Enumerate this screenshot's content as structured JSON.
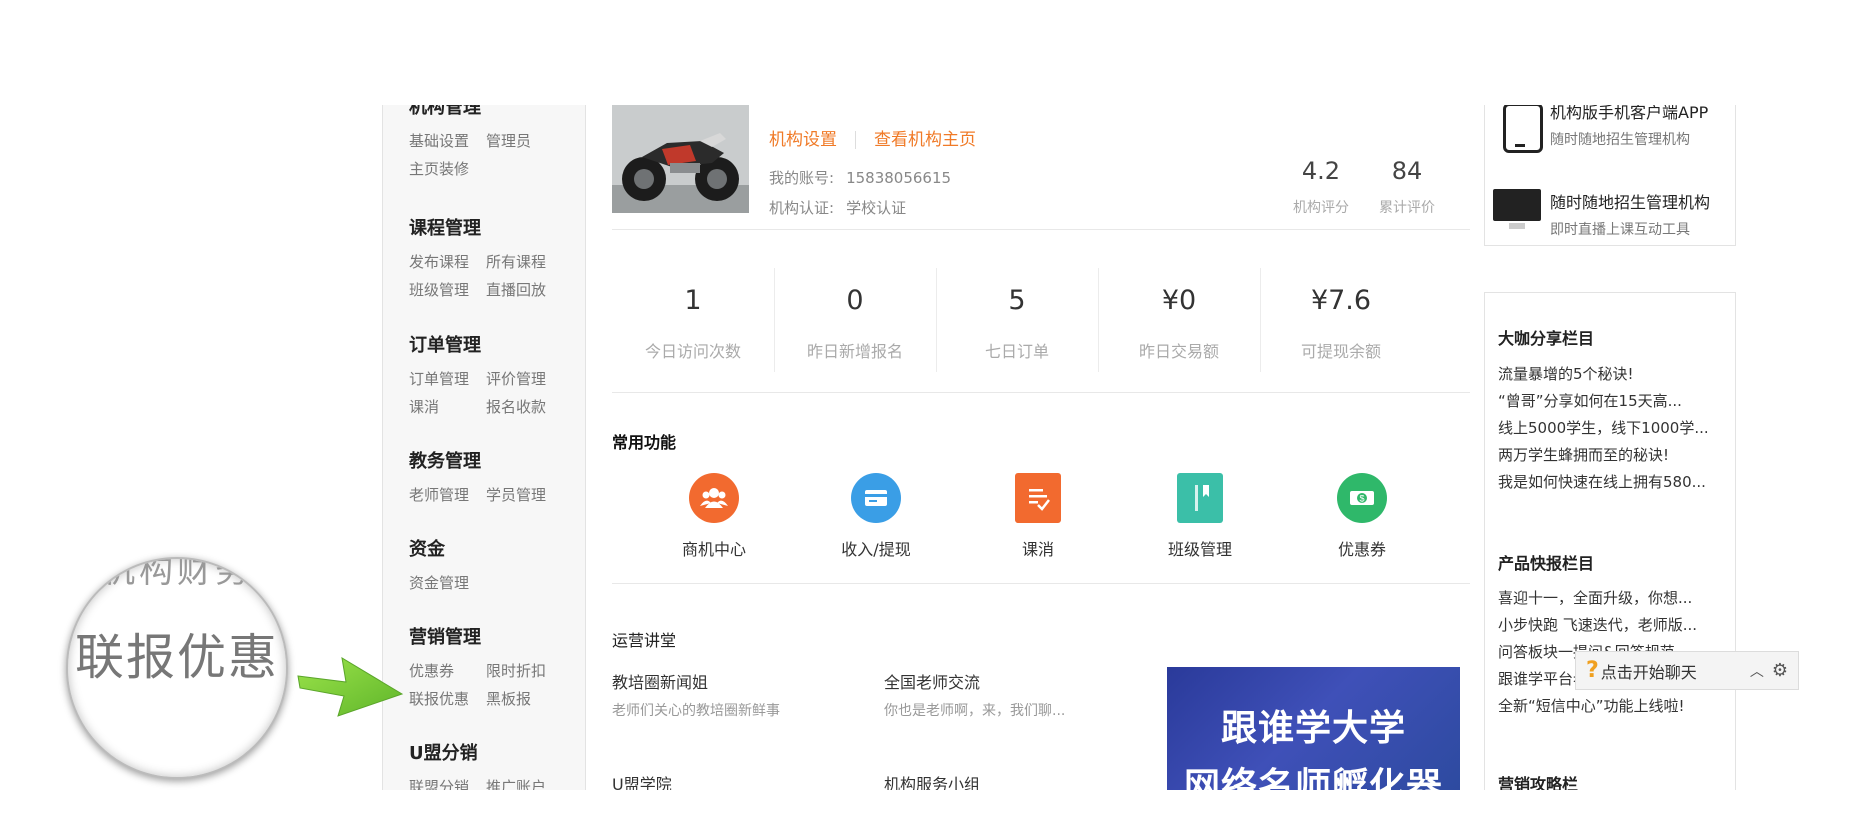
{
  "sidebar": {
    "groups": [
      {
        "title": "机构管理",
        "links": [
          [
            "基础设置",
            "管理员"
          ],
          [
            "主页装修",
            ""
          ]
        ]
      },
      {
        "title": "课程管理",
        "links": [
          [
            "发布课程",
            "所有课程"
          ],
          [
            "班级管理",
            "直播回放"
          ]
        ]
      },
      {
        "title": "订单管理",
        "links": [
          [
            "订单管理",
            "评价管理"
          ],
          [
            "课消",
            "报名收款"
          ]
        ]
      },
      {
        "title": "教务管理",
        "links": [
          [
            "老师管理",
            "学员管理"
          ]
        ]
      },
      {
        "title": "资金",
        "links": [
          [
            "资金管理",
            ""
          ]
        ]
      },
      {
        "title": "营销管理",
        "links": [
          [
            "优惠券",
            "限时折扣"
          ],
          [
            "联报优惠",
            "黑板报"
          ]
        ]
      },
      {
        "title": "U盟分销",
        "links": [
          [
            "联盟分销",
            "推广账户"
          ]
        ]
      }
    ]
  },
  "org": {
    "settings_link": "机构设置",
    "homepage_link": "查看机构主页",
    "account_label": "我的账号:",
    "account_value": "15838056615",
    "cert_label": "机构认证:",
    "cert_value": "学校认证",
    "rating_value": "4.2",
    "rating_label": "机构评分",
    "reviews_value": "84",
    "reviews_label": "累计评价"
  },
  "stats": [
    {
      "value": "1",
      "label": "今日访问次数"
    },
    {
      "value": "0",
      "label": "昨日新增报名"
    },
    {
      "value": "5",
      "label": "七日订单"
    },
    {
      "value": "¥0",
      "label": "昨日交易额"
    },
    {
      "value": "¥7.6",
      "label": "可提现余额"
    }
  ],
  "functions": {
    "title": "常用功能",
    "items": [
      {
        "label": "商机中心",
        "icon": "group-icon",
        "color": "#f26a2f"
      },
      {
        "label": "收入/提现",
        "icon": "card-icon",
        "color": "#3a9ee6"
      },
      {
        "label": "课消",
        "icon": "checklist-icon",
        "color": "#f26a2f"
      },
      {
        "label": "班级管理",
        "icon": "book-icon",
        "color": "#3bbfa8"
      },
      {
        "label": "优惠券",
        "icon": "cash-icon",
        "color": "#2fb86a"
      }
    ]
  },
  "ops": {
    "title": "运营讲堂",
    "items": [
      {
        "title": "教培圈新闻姐",
        "sub": "老师们关心的教培圈新鲜事"
      },
      {
        "title": "全国老师交流",
        "sub": "你也是老师啊，来，我们聊..."
      },
      {
        "title": "U盟学院",
        "sub": ""
      },
      {
        "title": "机构服务小组",
        "sub": ""
      }
    ],
    "banner_line1": "跟谁学大学",
    "banner_line2": "网络名师孵化器"
  },
  "right": {
    "apps": [
      {
        "title": "机构版手机客户端APP",
        "sub": "随时随地招生管理机构"
      },
      {
        "title": "随时随地招生管理机构",
        "sub": "即时直播上课互动工具"
      }
    ],
    "share_title": "大咖分享栏目",
    "share_items": [
      "流量暴增的5个秘诀!",
      "“曾哥”分享如何在15天高...",
      "线上5000学生，线下1000学...",
      "两万学生蜂拥而至的秘诀!",
      "我是如何快速在线上拥有580..."
    ],
    "news_title": "产品快报栏目",
    "news_items": [
      "喜迎十一，全面升级，你想...",
      "小步快跑 飞速迭代，老师版...",
      "问答板块一提问&回答规范",
      "跟谁学平台老师违规行为扣...",
      "全新“短信中心”功能上线啦!"
    ],
    "strategy_title": "营销攻略栏"
  },
  "chat": {
    "label": "点击开始聊天"
  },
  "magnifier": {
    "faint_text": "机构财务",
    "big_text": "联报优惠"
  }
}
